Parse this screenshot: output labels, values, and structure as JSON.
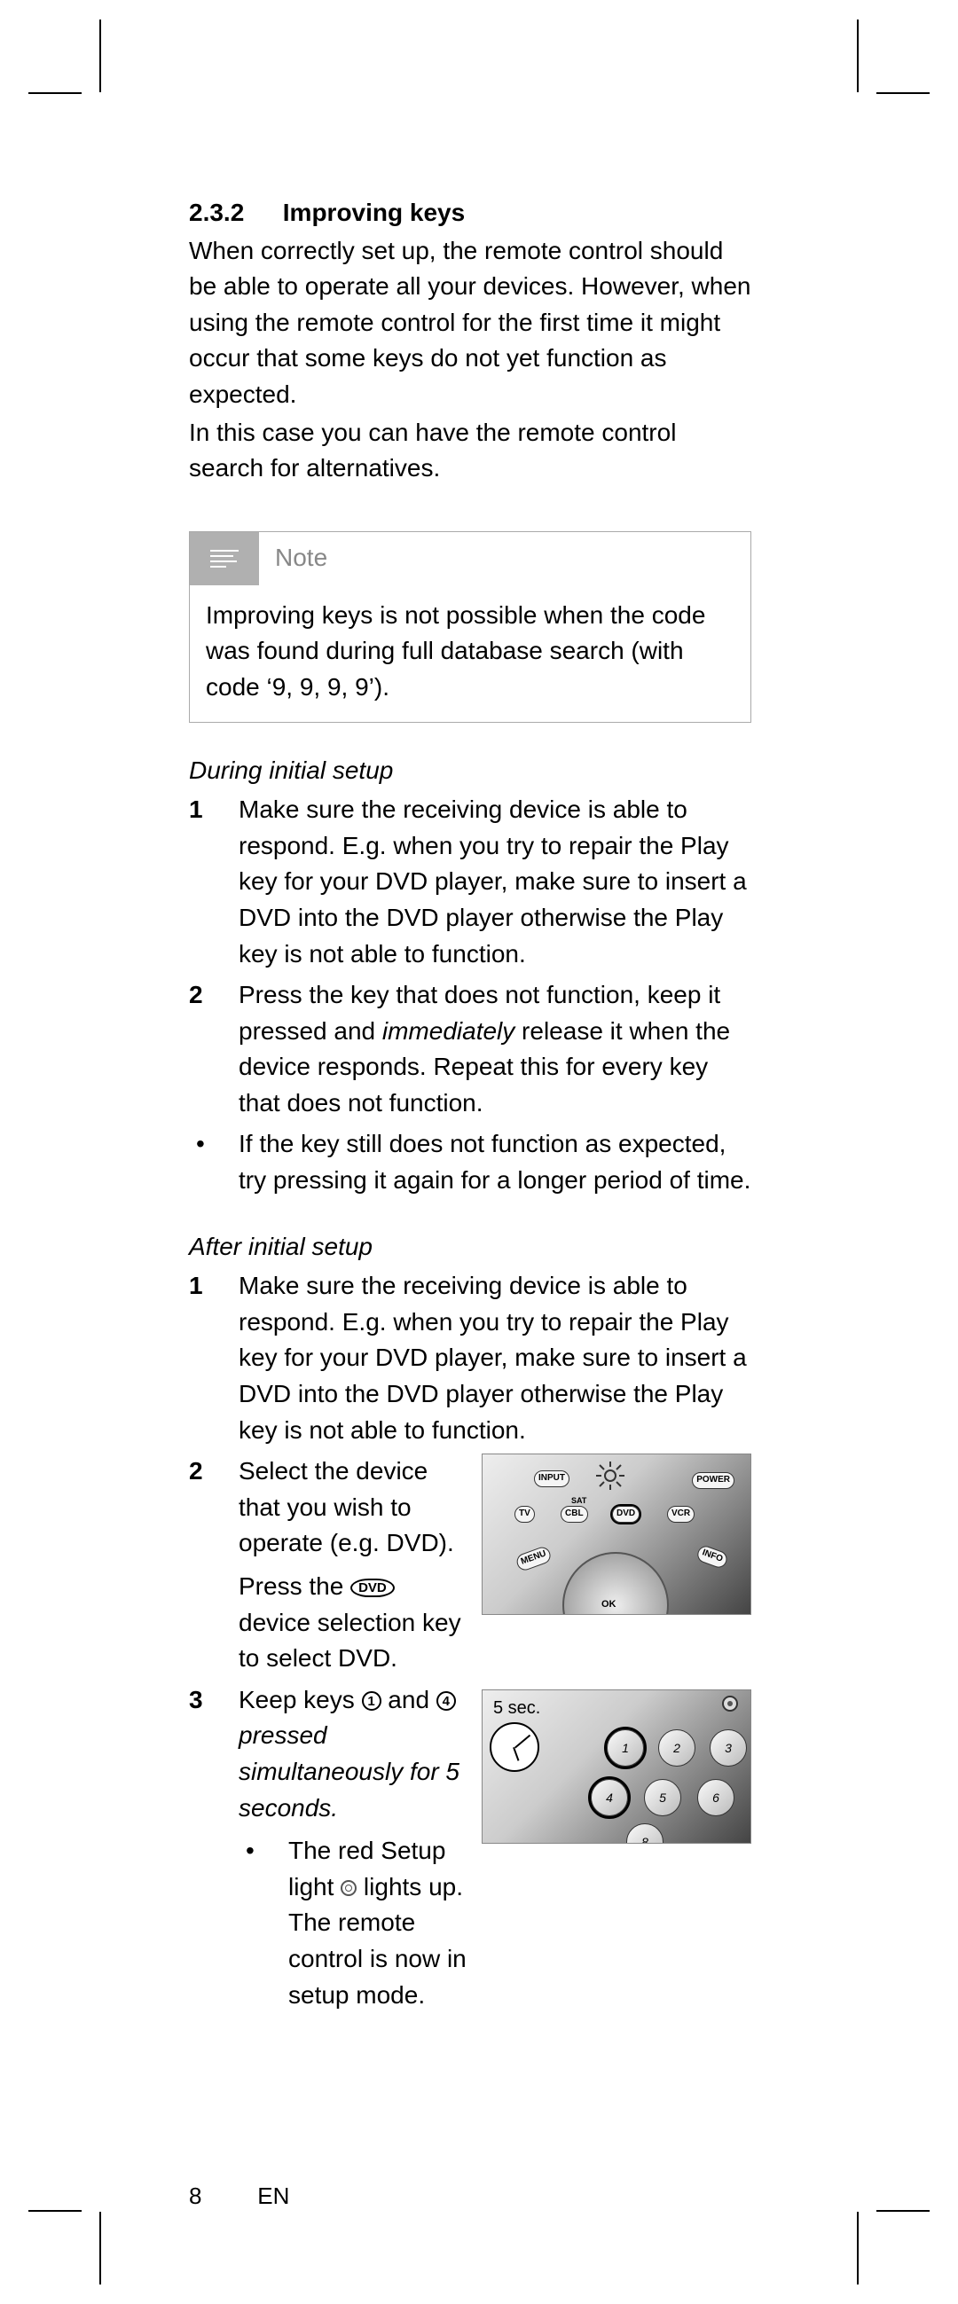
{
  "section": {
    "number": "2.3.2",
    "title": "Improving keys",
    "para1": "When correctly set up, the remote control should be able to operate all your devices. However, when using the remote control for the first time it might occur that some keys do not yet function as expected.",
    "para2": "In this case you can have the remote control search for alternatives."
  },
  "note": {
    "label": "Note",
    "body": "Improving keys is not possible when the code was found during full database search (with code ‘9, 9, 9, 9’)."
  },
  "initial": {
    "heading": "During initial setup",
    "steps": [
      "Make sure the receiving device is able to respond. E.g. when you try to repair the Play key for your DVD player, make sure to insert a DVD into the DVD player otherwise the Play key is not able to function.",
      {
        "pre": "Press the key that does not function, keep it pressed and ",
        "em": "immediately",
        "post": " release it when the device responds. Repeat this for every key that does not function."
      }
    ],
    "bullet": "If the key still does not function as expected, try pressing it again for a longer period of time."
  },
  "after": {
    "heading": "After initial setup",
    "step1": "Make sure the receiving device is able to respond. E.g. when you try to repair the Play key for your DVD player, make sure to insert a DVD into the DVD player otherwise the Play key is not able to function.",
    "step2a": "Select the device that you wish to operate (e.g. DVD).",
    "step2b_pre": "Press the ",
    "step2b_key": "DVD",
    "step2b_post": " device selection key to select DVD.",
    "step3_pre": "Keep keys ",
    "step3_key1": "1",
    "step3_mid1": " and ",
    "step3_key2": "4",
    "step3_em": " pressed simultaneously for 5 seconds.",
    "step3_bullet_pre": "The red Setup light ",
    "step3_bullet_post": " lights up. The remote control is now in setup mode."
  },
  "img2": {
    "five_sec": "5 sec."
  },
  "footer": {
    "page": "8",
    "lang": "EN"
  },
  "remote_labels": {
    "input": "INPUT",
    "power": "POWER",
    "sat": "SAT",
    "tv": "TV",
    "cbl": "CBL",
    "dvd": "DVD",
    "vcr": "VCR",
    "menu": "MENU",
    "info": "INFO",
    "ok": "OK"
  }
}
